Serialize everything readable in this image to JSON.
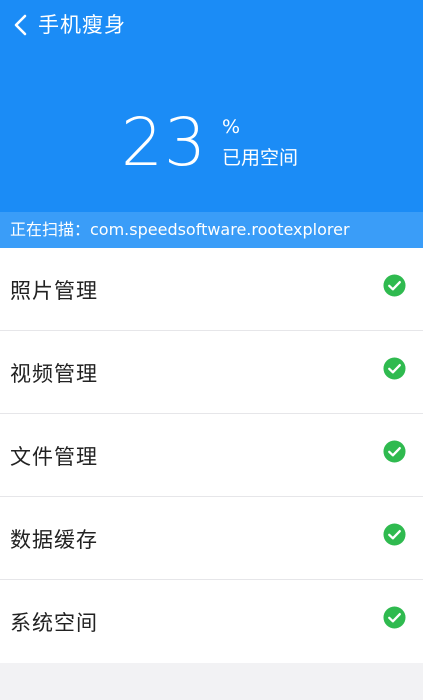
{
  "header": {
    "title": "手机瘦身",
    "back_icon": "chevron-left-icon",
    "background_color": "#1b8cf6"
  },
  "usage": {
    "value": "23",
    "unit": "%",
    "label": "已用空间",
    "percent": 23
  },
  "scan": {
    "text": "正在扫描：com.speedsoftware.rootexplorer",
    "background_color": "#3a9df8"
  },
  "items": [
    {
      "label": "照片管理",
      "status_icon": "check-circle-icon",
      "status": "done"
    },
    {
      "label": "视频管理",
      "status_icon": "check-circle-icon",
      "status": "done"
    },
    {
      "label": "文件管理",
      "status_icon": "check-circle-icon",
      "status": "done"
    },
    {
      "label": "数据缓存",
      "status_icon": "check-circle-icon",
      "status": "done"
    },
    {
      "label": "系统空间",
      "status_icon": "check-circle-icon",
      "status": "done"
    }
  ],
  "colors": {
    "check": "#2fba4f",
    "page_background": "#f2f2f4"
  }
}
